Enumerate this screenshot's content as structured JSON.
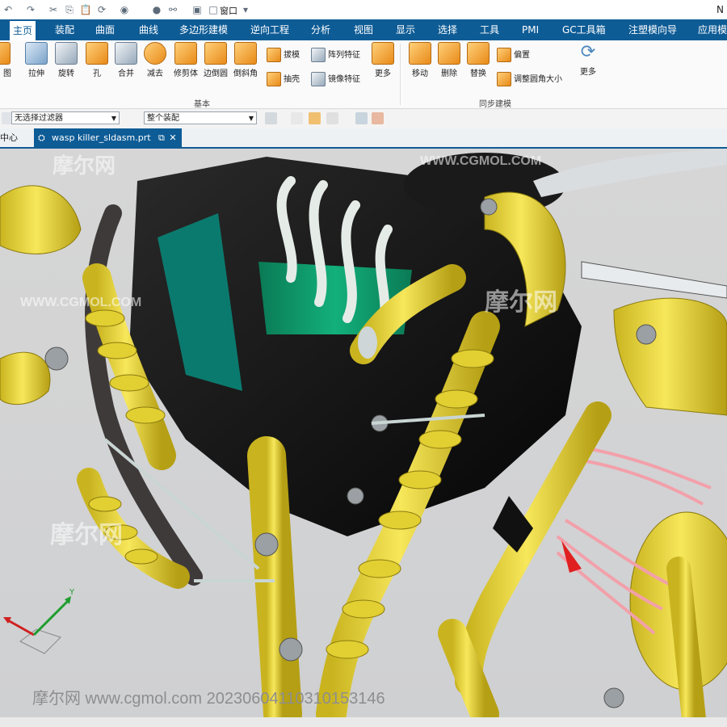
{
  "window": {
    "menu_label": "窗口",
    "app_letter": "N"
  },
  "menu": {
    "tabs": [
      {
        "label": "主页",
        "active": true
      },
      {
        "label": "装配"
      },
      {
        "label": "曲面"
      },
      {
        "label": "曲线"
      },
      {
        "label": "多边形建模"
      },
      {
        "label": "逆向工程"
      },
      {
        "label": "分析"
      },
      {
        "label": "视图"
      },
      {
        "label": "显示"
      },
      {
        "label": "选择"
      },
      {
        "label": "工具"
      },
      {
        "label": "PMI"
      },
      {
        "label": "GC工具箱"
      },
      {
        "label": "注塑模向导"
      },
      {
        "label": "应用模"
      }
    ]
  },
  "ribbon": {
    "cut_label": "图",
    "basic_tools": [
      {
        "label": "拉伸",
        "icon": "extrude-icon"
      },
      {
        "label": "旋转",
        "icon": "revolve-icon"
      },
      {
        "label": "孔",
        "icon": "hole-icon"
      },
      {
        "label": "合并",
        "icon": "unite-icon"
      },
      {
        "label": "减去",
        "icon": "subtract-icon"
      },
      {
        "label": "修剪体",
        "icon": "trim-body-icon"
      },
      {
        "label": "边倒圆",
        "icon": "edge-blend-icon"
      },
      {
        "label": "倒斜角",
        "icon": "chamfer-icon"
      }
    ],
    "basic_small": [
      {
        "label": "拔模",
        "icon": "draft-icon"
      },
      {
        "label": "阵列特征",
        "icon": "pattern-feature-icon"
      },
      {
        "label": "抽壳",
        "icon": "shell-icon"
      },
      {
        "label": "镜像特征",
        "icon": "mirror-feature-icon"
      }
    ],
    "basic_more": "更多",
    "basic_group": "基本",
    "sync_tools": [
      {
        "label": "移动",
        "icon": "move-face-icon"
      },
      {
        "label": "删除",
        "icon": "delete-face-icon"
      },
      {
        "label": "替换",
        "icon": "replace-face-icon"
      }
    ],
    "sync_small": [
      {
        "label": "偏置",
        "icon": "offset-face-icon"
      },
      {
        "label": "调整圆角大小",
        "icon": "resize-blend-icon"
      }
    ],
    "sync_more": "更多",
    "sync_group": "同步建模"
  },
  "filterbar": {
    "filter_value": "无选择过滤器",
    "scope_value": "整个装配"
  },
  "tabs": {
    "left_fragment": "中心",
    "active_file": "wasp killer_sldasm.prt"
  },
  "csys": {
    "y_label": "Y"
  },
  "watermarks": {
    "brand": "摩尔网",
    "site": "WWW.CGMOL.COM",
    "bottom": "摩尔网 www.cgmol.com 20230604110310153146"
  },
  "colors": {
    "menu_bg": "#0e5c96",
    "part_yellow": "#f2dd3d",
    "part_black": "#101010",
    "part_green": "#0c9a6a",
    "wire_pink": "#f2a0aa",
    "viewport_bg": "#d3d3d3"
  }
}
